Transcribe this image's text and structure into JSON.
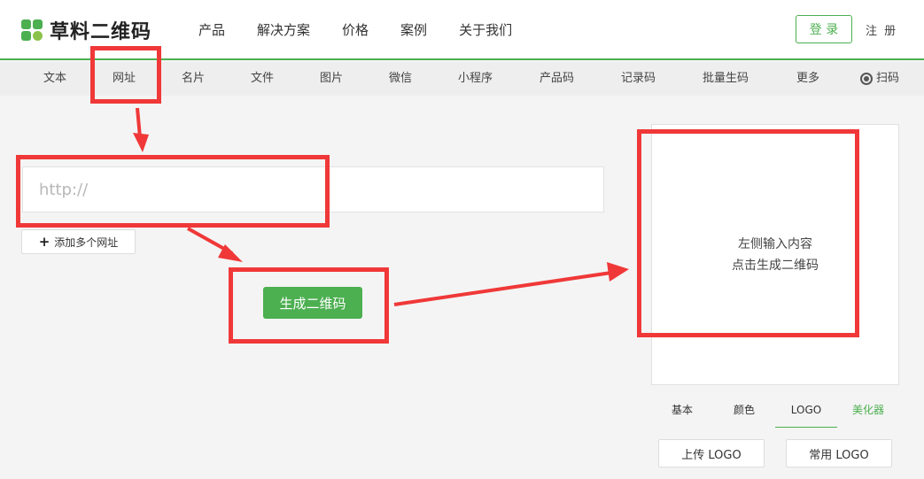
{
  "header": {
    "logo_text": "草料二维码",
    "nav": [
      "产品",
      "解决方案",
      "价格",
      "案例",
      "关于我们"
    ],
    "login_label": "登 录",
    "register_label": "注 册"
  },
  "subnav": {
    "items": [
      "文本",
      "网址",
      "名片",
      "文件",
      "图片",
      "微信",
      "小程序",
      "产品码",
      "记录码",
      "批量生码",
      "更多"
    ],
    "scan_label": "扫码"
  },
  "form": {
    "url_placeholder": "http://",
    "add_url_label": "添加多个网址",
    "generate_label": "生成二维码"
  },
  "preview": {
    "hint_line1": "左侧输入内容",
    "hint_line2": "点击生成二维码"
  },
  "style_tabs": [
    "基本",
    "颜色",
    "LOGO",
    "美化器"
  ],
  "logo_buttons": {
    "upload_label": "上传 LOGO",
    "common_label": "常用 LOGO"
  },
  "colors": {
    "brand": "#4caf50",
    "annotation": "#f03838"
  }
}
